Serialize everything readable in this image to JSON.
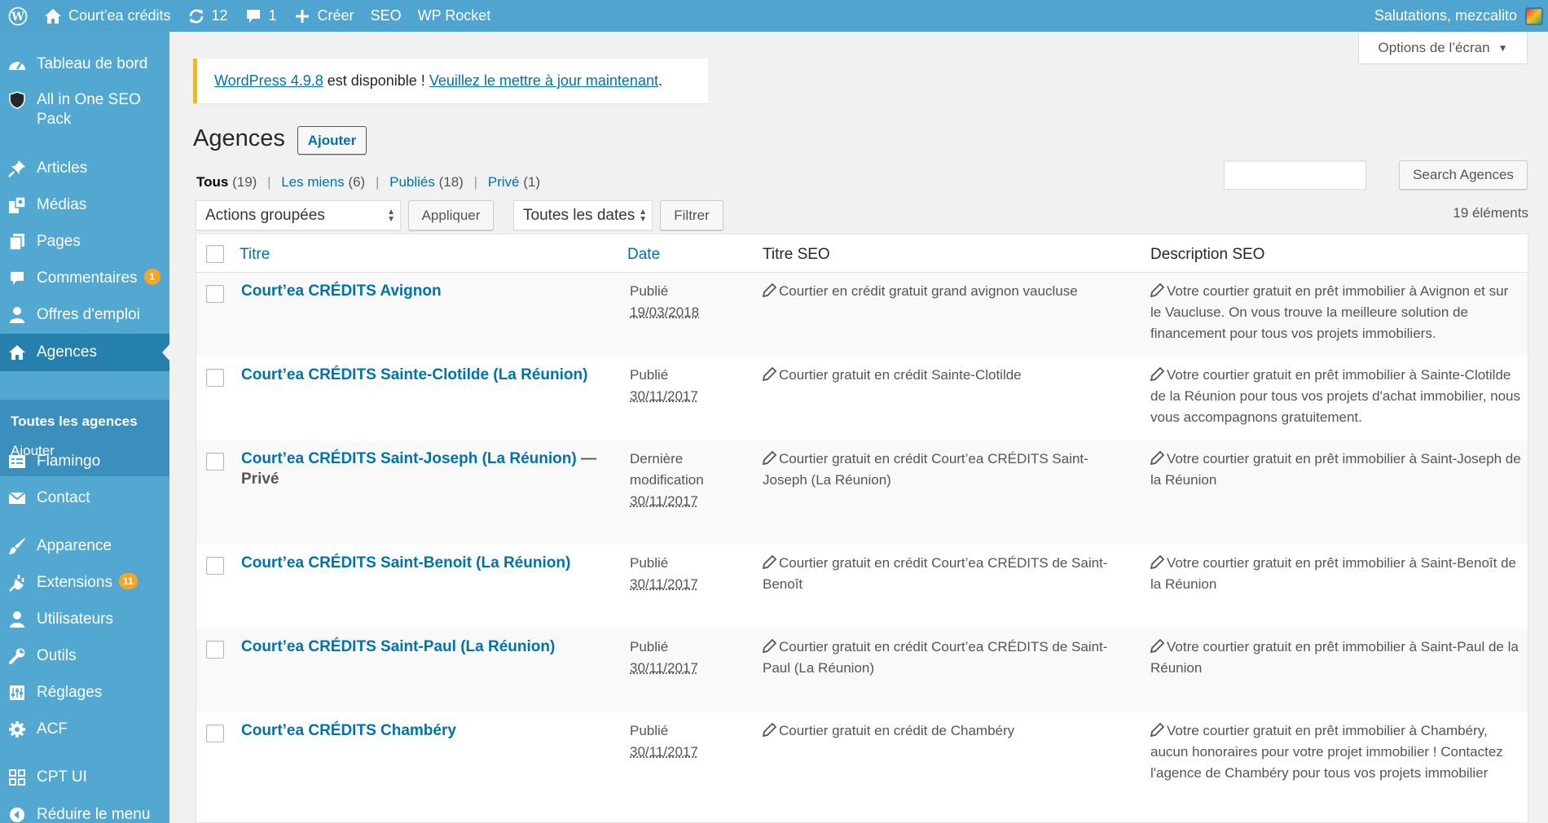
{
  "admin_bar": {
    "site_name": "Court'ea crédits",
    "updates_count": "12",
    "comments_count": "1",
    "new_label": "Créer",
    "seo_label": "SEO",
    "rocket_label": "WP Rocket",
    "greeting": "Salutations, mezcalito"
  },
  "sidebar": {
    "items": [
      {
        "label": "Tableau de bord",
        "icon": "dashboard-icon"
      },
      {
        "label": "All in One SEO Pack",
        "icon": "shield-icon"
      },
      {
        "label": "Articles",
        "icon": "pin-icon"
      },
      {
        "label": "Médias",
        "icon": "media-icon"
      },
      {
        "label": "Pages",
        "icon": "pages-icon"
      },
      {
        "label": "Commentaires",
        "icon": "comment-icon",
        "badge": "1"
      },
      {
        "label": "Offres d'emploi",
        "icon": "user-icon"
      },
      {
        "label": "Agences",
        "icon": "home-icon"
      },
      {
        "label": "Flamingo",
        "icon": "flamingo-icon"
      },
      {
        "label": "Contact",
        "icon": "mail-icon"
      },
      {
        "label": "Apparence",
        "icon": "brush-icon"
      },
      {
        "label": "Extensions",
        "icon": "plugin-icon",
        "badge": "11"
      },
      {
        "label": "Utilisateurs",
        "icon": "users-icon"
      },
      {
        "label": "Outils",
        "icon": "wrench-icon"
      },
      {
        "label": "Réglages",
        "icon": "settings-icon"
      },
      {
        "label": "ACF",
        "icon": "gear-icon"
      },
      {
        "label": "CPT UI",
        "icon": "grid-icon"
      },
      {
        "label": "Réduire le menu",
        "icon": "collapse-icon"
      }
    ],
    "submenu": [
      "Toutes les agences",
      "Ajouter"
    ]
  },
  "screen_options": "Options de l’écran",
  "notice": {
    "version_link": "WordPress 4.9.8",
    "middle": " est disponible ! ",
    "update_link": "Veuillez le mettre à jour maintenant",
    "end": "."
  },
  "page": {
    "title": "Agences",
    "add_button": "Ajouter"
  },
  "views": [
    {
      "label": "Tous",
      "count": "(19)"
    },
    {
      "label": "Les miens",
      "count": "(6)"
    },
    {
      "label": "Publiés",
      "count": "(18)"
    },
    {
      "label": "Privé",
      "count": "(1)"
    }
  ],
  "search_button": "Search Agences",
  "bulk_actions": "Actions groupées",
  "apply_button": "Appliquer",
  "dates_select": "Toutes les dates",
  "filter_button": "Filtrer",
  "items_count": "19 éléments",
  "table": {
    "headers": {
      "title": "Titre",
      "date": "Date",
      "seo_title": "Titre SEO",
      "seo_desc": "Description SEO"
    },
    "rows": [
      {
        "title": "Court’ea CRÉDITS Avignon",
        "state": "",
        "status": "Publié",
        "date": "19/03/2018",
        "seo_title": "Courtier en crédit gratuit grand avignon vaucluse",
        "seo_desc": "Votre courtier gratuit en prêt immobilier à Avignon et sur le Vaucluse. On vous trouve la meilleure solution de financement pour tous vos projets immobiliers."
      },
      {
        "title": "Court’ea CRÉDITS Sainte-Clotilde (La Réunion)",
        "state": "",
        "status": "Publié",
        "date": "30/11/2017",
        "seo_title": "Courtier gratuit en crédit Sainte-Clotilde",
        "seo_desc": "Votre courtier gratuit en prêt immobilier à Sainte-Clotilde de la Réunion pour tous vos projets d'achat immobilier, nous vous accompagnons gratuitement."
      },
      {
        "title": "Court’ea CRÉDITS Saint-Joseph (La Réunion)",
        "state": "— Privé",
        "status": "Dernière modification",
        "date": "30/11/2017",
        "seo_title": "Courtier gratuit en crédit Court’ea CRÉDITS Saint-Joseph (La Réunion)",
        "seo_desc": "Votre courtier gratuit en prêt immobilier à Saint-Joseph de la Réunion"
      },
      {
        "title": "Court’ea CRÉDITS Saint-Benoit (La Réunion)",
        "state": "",
        "status": "Publié",
        "date": "30/11/2017",
        "seo_title": "Courtier gratuit en crédit Court’ea CRÉDITS de Saint-Benoît",
        "seo_desc": "Votre courtier gratuit en prêt immobilier à Saint-Benoît de la Réunion"
      },
      {
        "title": "Court’ea CRÉDITS Saint-Paul (La Réunion)",
        "state": "",
        "status": "Publié",
        "date": "30/11/2017",
        "seo_title": "Courtier gratuit en crédit Court’ea CRÉDITS de Saint-Paul (La Réunion)",
        "seo_desc": "Votre courtier gratuit en prêt immobilier à Saint-Paul de la Réunion"
      },
      {
        "title": "Court’ea CRÉDITS Chambéry",
        "state": "",
        "status": "Publié",
        "date": "30/11/2017",
        "seo_title": "Courtier gratuit en crédit de Chambéry",
        "seo_desc": "Votre courtier gratuit en prêt immobilier à Chambéry, aucun honoraires pour votre projet immobilier ! Contactez l'agence de Chambéry pour tous vos projets immobilier"
      }
    ]
  }
}
